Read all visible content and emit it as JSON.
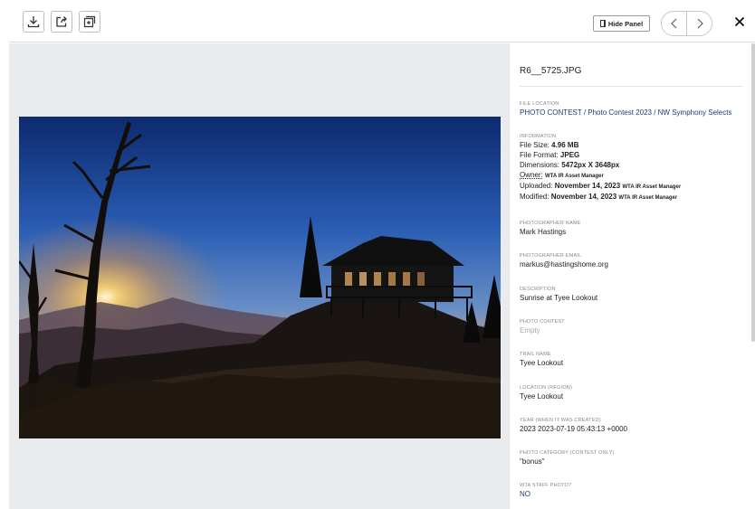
{
  "toolbar": {
    "hide_panel_label": "Hide Panel"
  },
  "photo": {
    "alt": "Sunrise at Tyee Lookout"
  },
  "details": {
    "file_name": "R6__5725.JPG",
    "file_location": {
      "label": "FILE LOCATION",
      "value": "PHOTO CONTEST / Photo Contest 2023 / NW Symphony Selects"
    },
    "information": {
      "label": "INFORMATION",
      "file_size_label": "File Size: ",
      "file_size": "4.96 MB",
      "file_format_label": "File Format: ",
      "file_format": "JPEG",
      "dimensions_label": "Dimensions: ",
      "dimensions": "5472px X 3648px",
      "owner_label": "Owner:",
      "owner": "WTA IR Asset Manager",
      "uploaded_label": "Uploaded: ",
      "uploaded_date": "November 14, 2023",
      "uploaded_by": "WTA IR Asset Manager",
      "modified_label": "Modified: ",
      "modified_date": "November 14, 2023",
      "modified_by": "WTA IR Asset Manager"
    },
    "photographer_name": {
      "label": "PHOTOGRAPHER NAME",
      "value": "Mark Hastings"
    },
    "photographer_email": {
      "label": "PHOTOGRAPHER EMAIL",
      "value": "markus@hastingshome.org"
    },
    "description": {
      "label": "DESCRIPTION",
      "value": "Sunrise at Tyee Lookout"
    },
    "photo_contest": {
      "label": "PHOTO CONTEST",
      "value": "Empty"
    },
    "trail_name": {
      "label": "TRAIL NAME",
      "value": "Tyee Lookout"
    },
    "location_region": {
      "label": "LOCATION (REGION)",
      "value": "Tyee Lookout"
    },
    "year": {
      "label": "YEAR (WHEN IT WAS CREATED)",
      "value": "2023 2023-07-19 05:43:13 +0000"
    },
    "photo_category": {
      "label": "PHOTO CATEGORY (CONTEST ONLY)",
      "value": "\"bonus\""
    },
    "wta_staff_photo": {
      "label": "WTA STAFF PHOTO?",
      "value": "NO"
    }
  },
  "colors": {
    "link": "#1d3b78",
    "viewer_bg": "#eaebee"
  }
}
